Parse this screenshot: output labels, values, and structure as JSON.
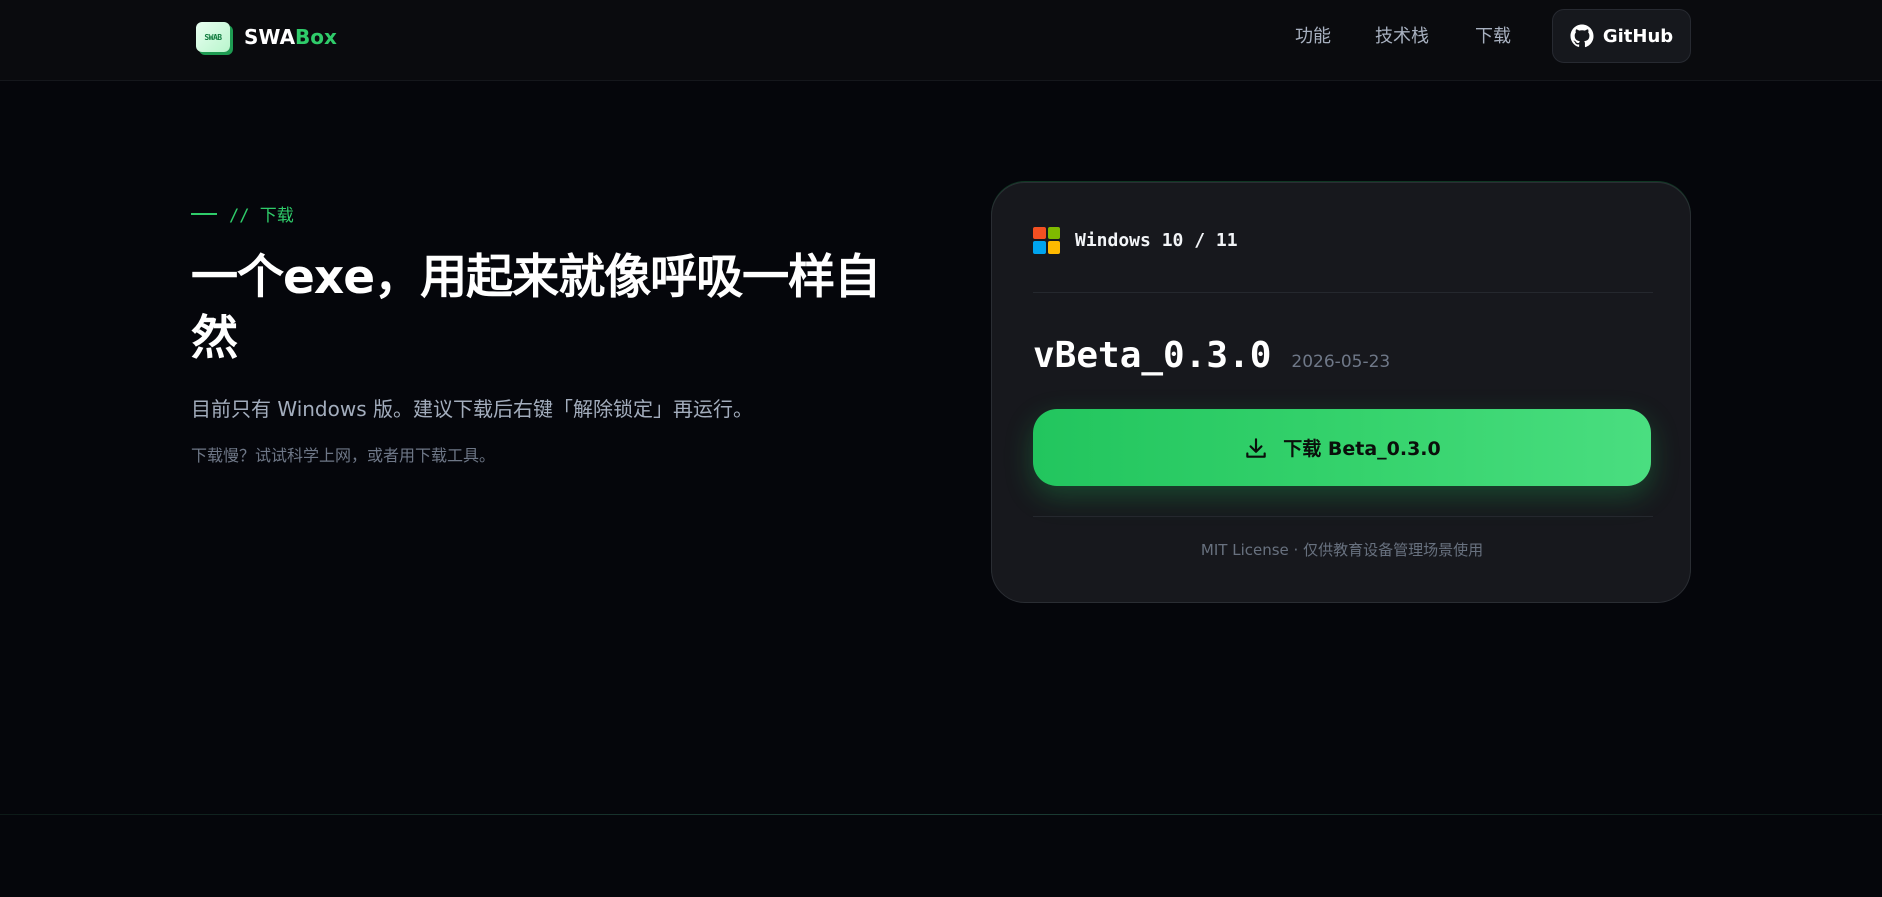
{
  "brand": {
    "logo_text": "SWAB",
    "name_part1": "SWA",
    "name_part2": "Box"
  },
  "nav": {
    "items": [
      {
        "label": "功能"
      },
      {
        "label": "技术栈"
      },
      {
        "label": "下载"
      }
    ],
    "github_label": "GitHub"
  },
  "hero": {
    "eyebrow": "// 下载",
    "title": "一个exe，用起来就像呼吸一样自然",
    "subtitle": "目前只有 Windows 版。建议下载后右键「解除锁定」再运行。",
    "note": "下载慢？试试科学上网，或者用下载工具。"
  },
  "card": {
    "os_name": "Windows 10 / 11",
    "version": "vBeta_0.3.0",
    "release_date": "2026-05-23",
    "download_label": "下载 Beta_0.3.0",
    "license": "MIT License · 仅供教育设备管理场景使用"
  },
  "icons": {
    "logo": "swab-logo",
    "github": "github-icon",
    "windows": "windows-logo-icon",
    "download": "download-icon"
  },
  "colors": {
    "background": "#05060b",
    "accent": "#2fcc6a",
    "card": "#17181d",
    "windows_red": "#f25022",
    "windows_green": "#7fba00",
    "windows_blue": "#00a4ef",
    "windows_yellow": "#ffb900"
  }
}
